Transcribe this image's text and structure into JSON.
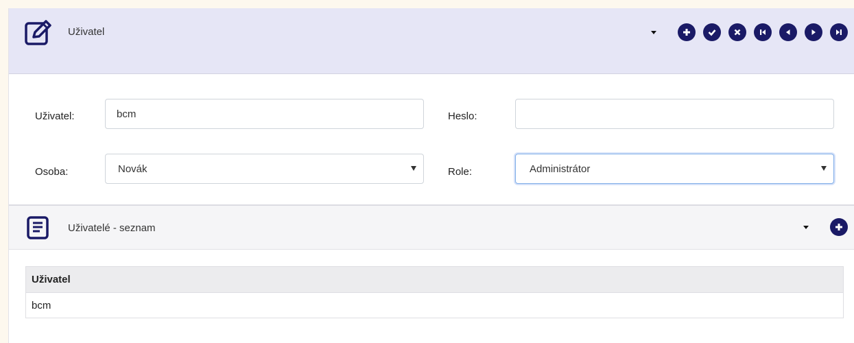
{
  "edit_panel": {
    "title": "Uživatel",
    "icon": "edit-square-icon",
    "toolbar": [
      "dropdown-caret",
      "add-icon",
      "confirm-icon",
      "cancel-icon",
      "first-icon",
      "previous-icon",
      "next-icon",
      "last-icon"
    ]
  },
  "form": {
    "user_label": "Uživatel:",
    "user_value": "bcm",
    "password_label": "Heslo:",
    "password_value": "",
    "person_label": "Osoba:",
    "person_value": "Novák",
    "role_label": "Role:",
    "role_value": "Administrátor"
  },
  "list_panel": {
    "title": "Uživatelé - seznam",
    "icon": "list-document-icon",
    "table": {
      "headers": [
        "Uživatel"
      ],
      "rows": [
        [
          "bcm"
        ]
      ]
    }
  },
  "colors": {
    "accent": "#1a1a66",
    "header_bg": "#e6e6f6",
    "focus_border": "#80aee8"
  }
}
